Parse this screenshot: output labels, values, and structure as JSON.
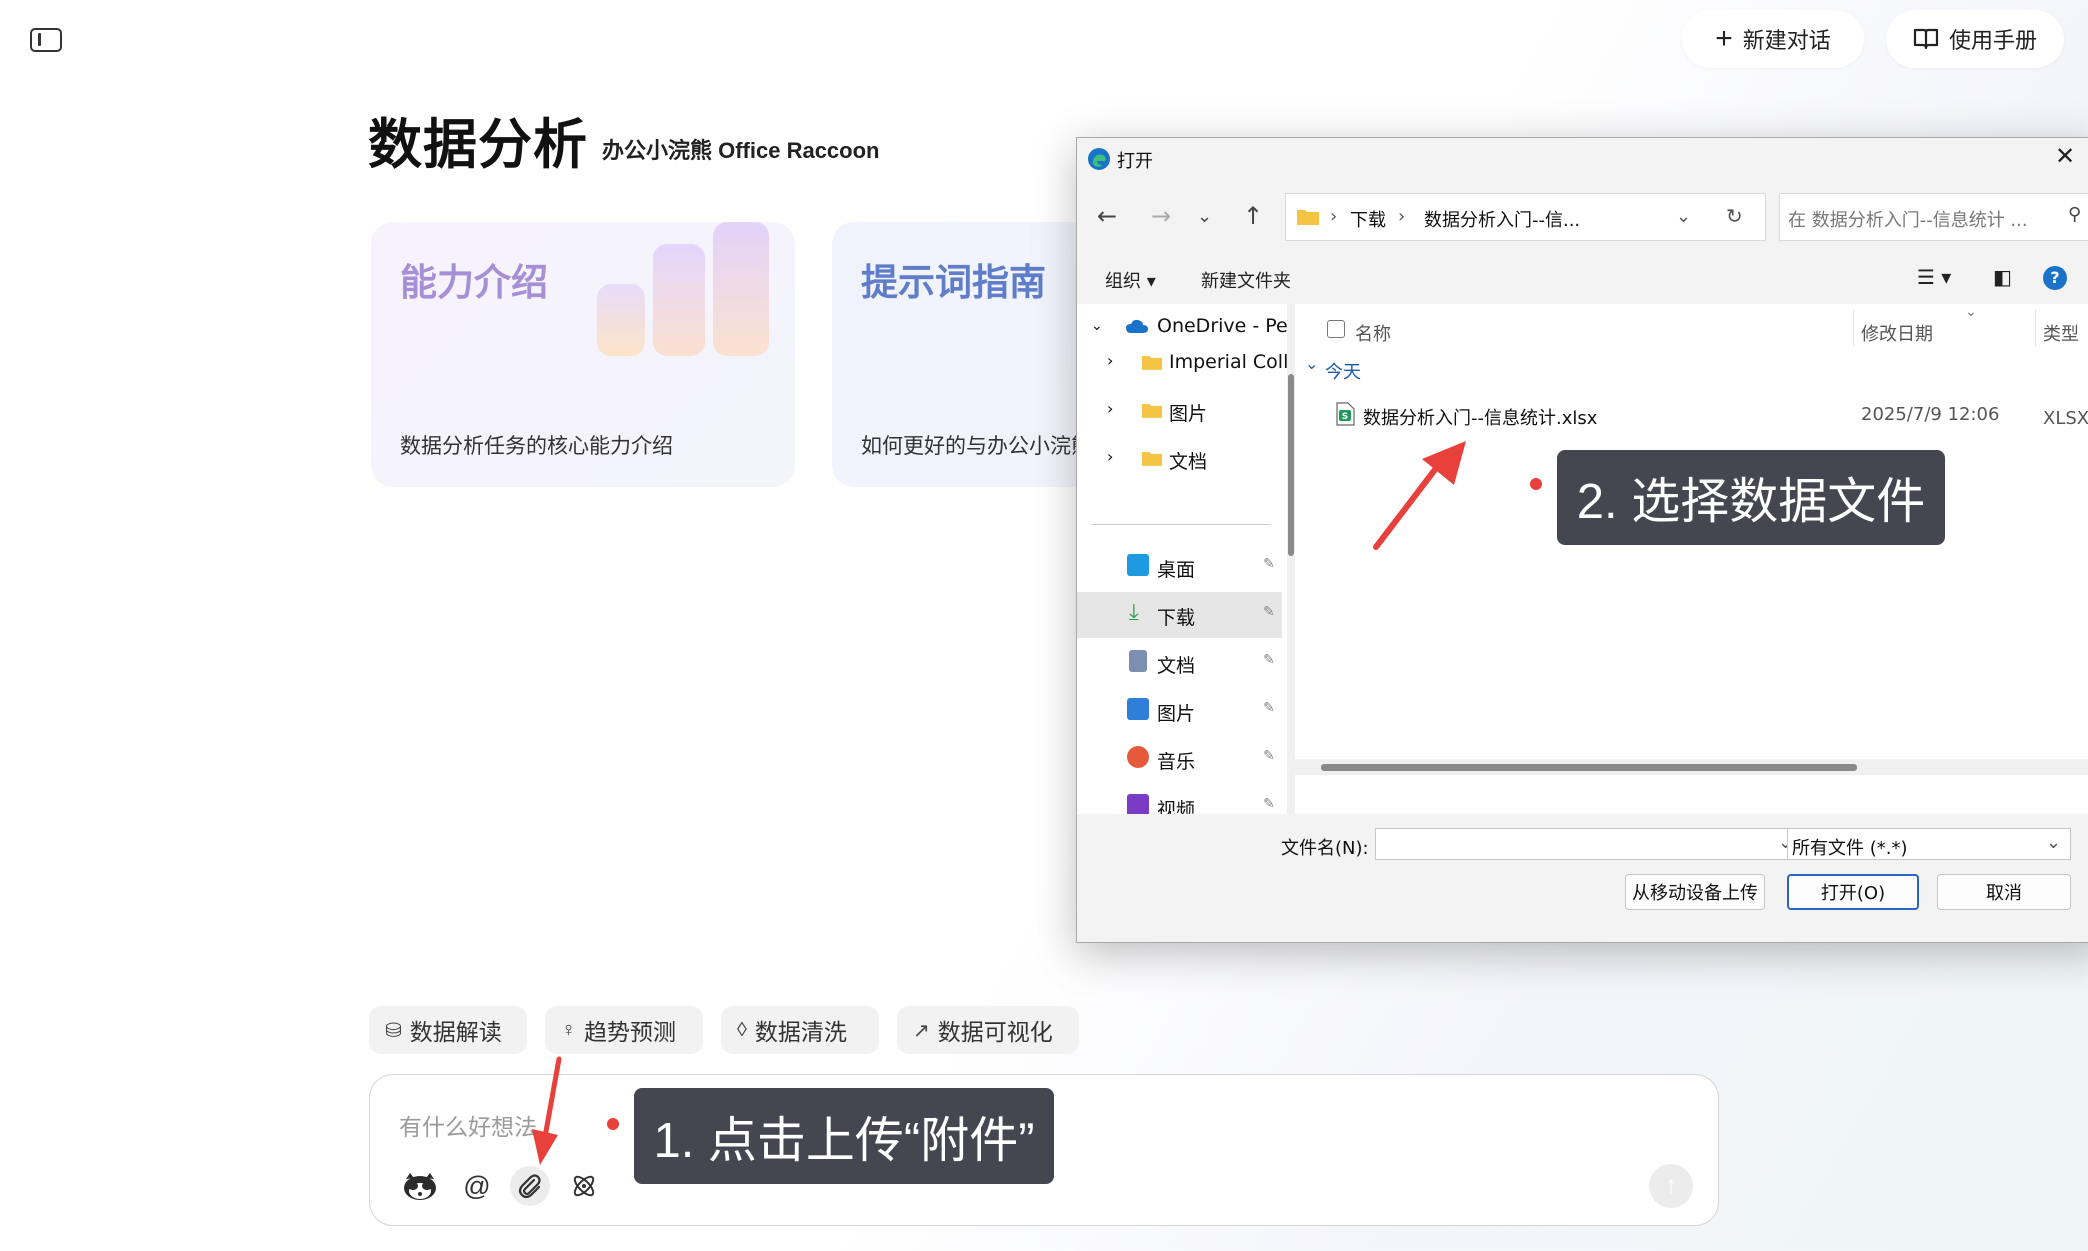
{
  "topbar": {
    "new_chat_label": "新建对话",
    "manual_label": "使用手册"
  },
  "page": {
    "title": "数据分析",
    "subtitle": "办公小浣熊 Office Raccoon"
  },
  "cards": [
    {
      "title": "能力介绍",
      "desc": "数据分析任务的核心能力介绍"
    },
    {
      "title": "提示词指南",
      "desc": "如何更好的与办公小浣熊"
    }
  ],
  "chips": [
    {
      "label": "数据解读",
      "icon": "database-icon"
    },
    {
      "label": "趋势预测",
      "icon": "lightbulb-icon"
    },
    {
      "label": "数据清洗",
      "icon": "droplet-icon"
    },
    {
      "label": "数据可视化",
      "icon": "chart-icon"
    }
  ],
  "input": {
    "placeholder": "有什么好想法"
  },
  "annotations": {
    "step1": "1. 点击上传“附件”",
    "step2": "2. 选择数据文件"
  },
  "dialog": {
    "title": "打开",
    "breadcrumb": [
      "下载",
      "数据分析入门--信..."
    ],
    "search_placeholder": "在 数据分析入门--信息统计 ...",
    "organize_label": "组织",
    "new_folder_label": "新建文件夹",
    "nav_tree": [
      {
        "label": "OneDrive - Per",
        "icon": "cloud-icon"
      },
      {
        "label": "Imperial Colle",
        "icon": "folder-icon"
      },
      {
        "label": "图片",
        "icon": "folder-icon"
      },
      {
        "label": "文档",
        "icon": "folder-icon"
      }
    ],
    "quick_access": [
      {
        "label": "桌面",
        "icon": "desktop-icon",
        "color": "#1e9be0"
      },
      {
        "label": "下载",
        "icon": "download-icon",
        "color": "#2a9d4a"
      },
      {
        "label": "文档",
        "icon": "document-icon",
        "color": "#7b8fb0"
      },
      {
        "label": "图片",
        "icon": "picture-icon",
        "color": "#2f7fd8"
      },
      {
        "label": "音乐",
        "icon": "music-icon",
        "color": "#e65a3c"
      },
      {
        "label": "视频",
        "icon": "video-icon",
        "color": "#7a3cc4"
      }
    ],
    "columns": {
      "name": "名称",
      "modified": "修改日期",
      "type": "类型"
    },
    "group_label": "今天",
    "files": [
      {
        "name": "数据分析入门--信息统计.xlsx",
        "modified": "2025/7/9 12:06",
        "type": "XLSX 工"
      }
    ],
    "filename_label": "文件名(N):",
    "filename_value": "",
    "filetype_value": "所有文件 (*.*)",
    "upload_mobile_label": "从移动设备上传",
    "open_label": "打开(O)",
    "cancel_label": "取消"
  }
}
